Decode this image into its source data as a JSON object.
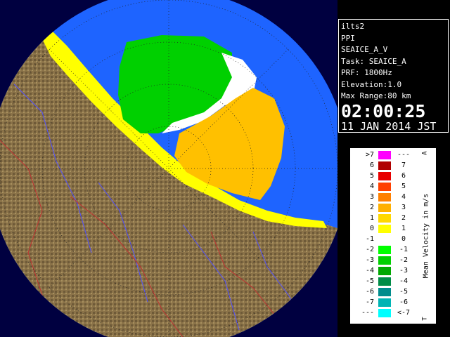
{
  "info_panel": {
    "station": "ilts2",
    "product": "PPI",
    "product_name": "SEAICE_A_V",
    "task": "Task: SEAICE_A",
    "prf": "PRF: 1800Hz",
    "elevation": "Elevation:1.0",
    "max_range": "Max Range:80 km",
    "time": "02:00:25",
    "date": "11 JAN 2014 JST"
  },
  "legend": {
    "unit": "Mean Velocity in m/s",
    "top_marker": "A",
    "bottom_marker": "T",
    "rows": [
      {
        "left": ">7",
        "right": "---",
        "color": "#ff00ff"
      },
      {
        "left": "6",
        "right": "7",
        "color": "#b00000"
      },
      {
        "left": "5",
        "right": "6",
        "color": "#e80000"
      },
      {
        "left": "4",
        "right": "5",
        "color": "#ff4000"
      },
      {
        "left": "3",
        "right": "4",
        "color": "#ff8000"
      },
      {
        "left": "2",
        "right": "3",
        "color": "#ffb000"
      },
      {
        "left": "1",
        "right": "2",
        "color": "#ffd800"
      },
      {
        "left": "0",
        "right": "1",
        "color": "#ffff00"
      },
      {
        "left": "-1",
        "right": "0",
        "color": "#ffffff"
      },
      {
        "left": "-2",
        "right": "-1",
        "color": "#00ff00"
      },
      {
        "left": "-3",
        "right": "-2",
        "color": "#00d000"
      },
      {
        "left": "-4",
        "right": "-3",
        "color": "#00a800"
      },
      {
        "left": "-5",
        "right": "-4",
        "color": "#008c46"
      },
      {
        "left": "-6",
        "right": "-5",
        "color": "#008c8c"
      },
      {
        "left": "-7",
        "right": "-6",
        "color": "#00b4b4"
      },
      {
        "left": "---",
        "right": "<-7",
        "color": "#00ffff"
      }
    ]
  },
  "colors": {
    "sea": "#1e64ff",
    "out_of_range": "#000040",
    "land": "#8b7349",
    "rivers": "#5050ff",
    "borders": "#c03030",
    "coast_echo": "#ffff00",
    "approaching_echo": "#00d000",
    "receding_echo": "#ffc000"
  }
}
